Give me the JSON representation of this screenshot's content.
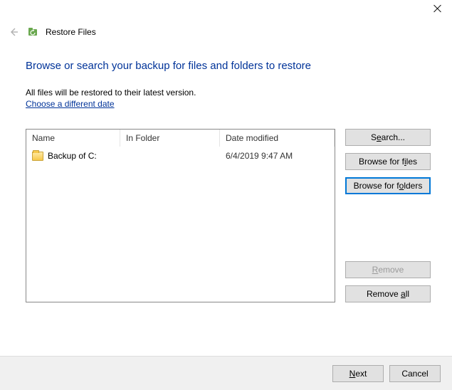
{
  "window": {
    "title": "Restore Files"
  },
  "page": {
    "headline": "Browse or search your backup for files and folders to restore",
    "subtext": "All files will be restored to their latest version.",
    "choose_date_link": "Choose a different date"
  },
  "list": {
    "columns": {
      "name": "Name",
      "in_folder": "In Folder",
      "date_modified": "Date modified"
    },
    "rows": [
      {
        "name": "Backup of C:",
        "in_folder": "",
        "date_modified": "6/4/2019 9:47 AM"
      }
    ]
  },
  "buttons": {
    "search_pre": "S",
    "search_ul": "e",
    "search_post": "arch...",
    "browse_files_pre": "Browse for f",
    "browse_files_ul": "i",
    "browse_files_post": "les",
    "browse_folders_pre": "Browse for f",
    "browse_folders_ul": "o",
    "browse_folders_post": "lders",
    "remove_pre": "",
    "remove_ul": "R",
    "remove_post": "emove",
    "remove_all_pre": "Remove ",
    "remove_all_ul": "a",
    "remove_all_post": "ll",
    "next_pre": "",
    "next_ul": "N",
    "next_post": "ext",
    "cancel": "Cancel"
  }
}
